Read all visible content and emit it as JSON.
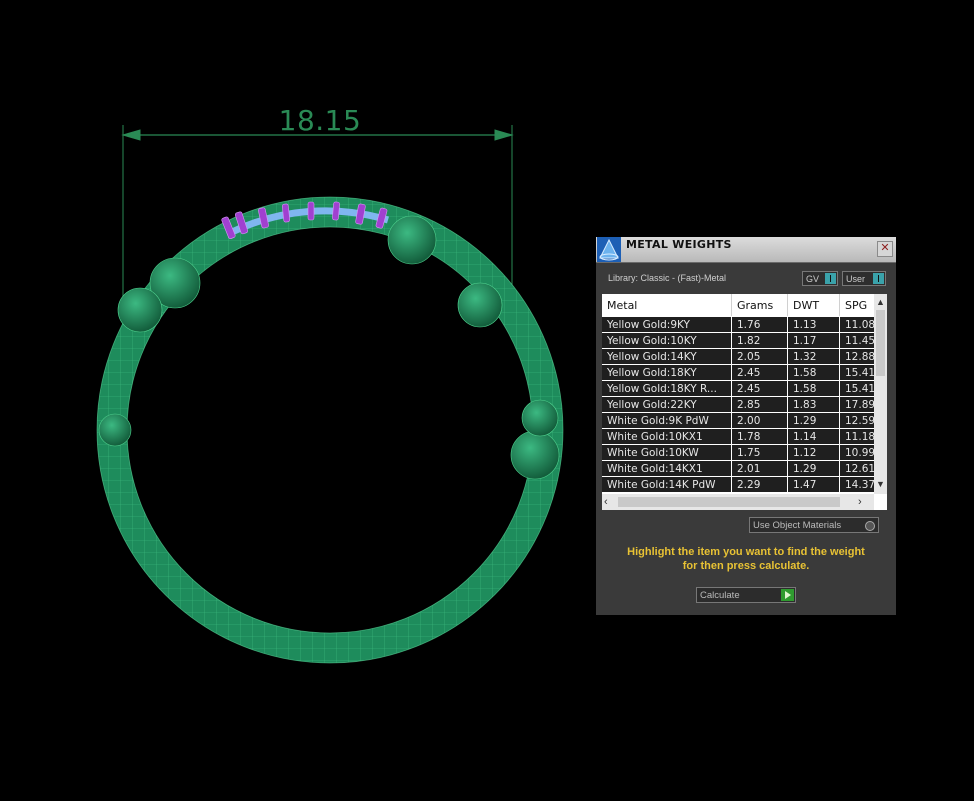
{
  "viewport": {
    "dimension_value": "18.15"
  },
  "panel": {
    "title": "METAL WEIGHTS",
    "close_label": "✕",
    "library_label": "Library: Classic - (Fast)-Metal",
    "gv_dropdown": "GV",
    "user_dropdown": "User",
    "columns": [
      "Metal",
      "Grams",
      "DWT",
      "SPG"
    ],
    "rows": [
      [
        "Yellow Gold:9KY",
        "1.76",
        "1.13",
        "11.08"
      ],
      [
        "Yellow Gold:10KY",
        "1.82",
        "1.17",
        "11.45"
      ],
      [
        "Yellow Gold:14KY",
        "2.05",
        "1.32",
        "12.88"
      ],
      [
        "Yellow Gold:18KY",
        "2.45",
        "1.58",
        "15.41"
      ],
      [
        "Yellow Gold:18KY R...",
        "2.45",
        "1.58",
        "15.41"
      ],
      [
        "Yellow Gold:22KY",
        "2.85",
        "1.83",
        "17.89"
      ],
      [
        "White Gold:9K PdW",
        "2.00",
        "1.29",
        "12.59"
      ],
      [
        "White Gold:10KX1",
        "1.78",
        "1.14",
        "11.18"
      ],
      [
        "White Gold:10KW",
        "1.75",
        "1.12",
        "10.99"
      ],
      [
        "White Gold:14KX1",
        "2.01",
        "1.29",
        "12.61"
      ],
      [
        "White Gold:14K PdW",
        "2.29",
        "1.47",
        "14.37"
      ]
    ],
    "use_object_materials": "Use Object Materials",
    "hint_line1": "Highlight the item you want to find the weight",
    "hint_line2": "for then press calculate.",
    "calculate_label": "Calculate"
  },
  "colors": {
    "background": "#000000",
    "ring": "#1e8c5c",
    "dimension": "#2a8a55",
    "prongs": "#a040d0",
    "hint": "#e8c234"
  }
}
